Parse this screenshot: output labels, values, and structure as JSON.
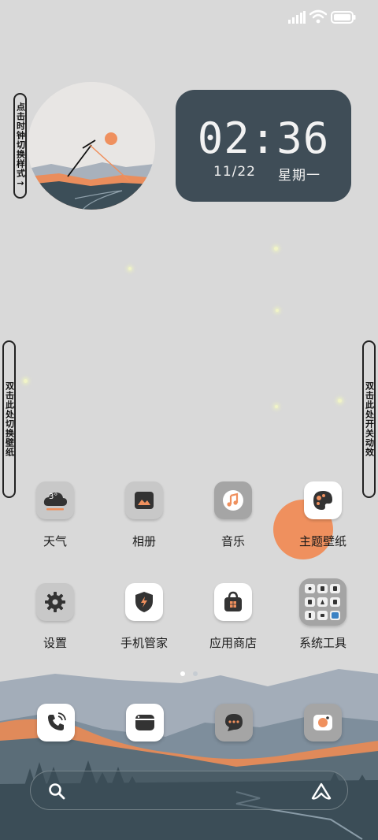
{
  "status_bar": {
    "icons": [
      "signal-icon",
      "wifi-icon",
      "battery-icon"
    ]
  },
  "side_pills": {
    "clock_style": "点击时钟切换样式→",
    "switch_wallpaper": "双击此处切换壁纸",
    "toggle_animation": "双击此处开关动效"
  },
  "clock": {
    "time": "02:36",
    "date": "11/22",
    "weekday": "星期一"
  },
  "apps": [
    {
      "label": "天气",
      "icon": "weather-icon",
      "badge": "3°"
    },
    {
      "label": "相册",
      "icon": "gallery-icon"
    },
    {
      "label": "音乐",
      "icon": "music-icon"
    },
    {
      "label": "主题壁纸",
      "icon": "theme-icon"
    },
    {
      "label": "设置",
      "icon": "settings-icon"
    },
    {
      "label": "手机管家",
      "icon": "security-icon"
    },
    {
      "label": "应用商店",
      "icon": "app-store-icon"
    },
    {
      "label": "系统工具",
      "icon": "system-tools-folder-icon"
    }
  ],
  "page_indicator": {
    "pages": 2,
    "current": 1
  },
  "dock": [
    {
      "icon": "phone-icon"
    },
    {
      "icon": "browser-icon"
    },
    {
      "icon": "messages-icon"
    },
    {
      "icon": "camera-icon"
    }
  ],
  "search_bar": {
    "left_icon": "search-icon",
    "right_icon": "assistant-icon"
  },
  "colors": {
    "background": "#d9d9d9",
    "clock_card": "#3f4d57",
    "accent_orange": "#ef905e",
    "mountain_blue": "#a3adb9",
    "mountain_dark": "#3b4d57"
  }
}
